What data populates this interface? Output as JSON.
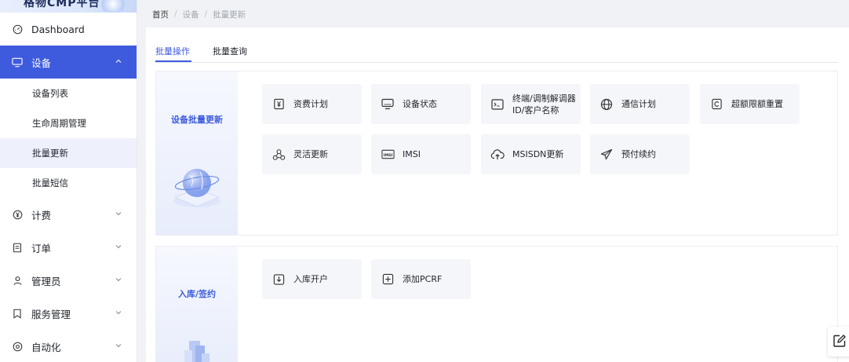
{
  "app": {
    "logo_text": "格物CMP平台"
  },
  "sidebar": {
    "items": [
      {
        "label": "Dashboard",
        "icon": "gauge-icon"
      },
      {
        "label": "设备",
        "icon": "monitor-icon",
        "active": true
      },
      {
        "label": "计费",
        "icon": "yen-icon"
      },
      {
        "label": "订单",
        "icon": "order-icon"
      },
      {
        "label": "管理员",
        "icon": "user-icon"
      },
      {
        "label": "服务管理",
        "icon": "bookmark-icon"
      },
      {
        "label": "自动化",
        "icon": "automation-icon"
      }
    ],
    "sub_items": [
      {
        "label": "设备列表"
      },
      {
        "label": "生命周期管理"
      },
      {
        "label": "批量更新",
        "current": true
      },
      {
        "label": "批量短信"
      }
    ]
  },
  "breadcrumb": {
    "home": "首页",
    "level1": "设备",
    "level2": "批量更新",
    "separator": "/"
  },
  "tabs": [
    {
      "label": "批量操作",
      "active": true
    },
    {
      "label": "批量查询"
    }
  ],
  "panels": [
    {
      "title": "设备批量更新",
      "cards": [
        {
          "label": "资费计划",
          "icon": "yen-doc-icon"
        },
        {
          "label": "设备状态",
          "icon": "monitor-icon"
        },
        {
          "label": "终端/调制解调器ID/客户名称",
          "label_line1": "终端/调制解调器",
          "label_line2": "ID/客户名称",
          "icon": "terminal-icon"
        },
        {
          "label": "通信计划",
          "icon": "globe-icon"
        },
        {
          "label": "超额限额重置",
          "icon": "reset-icon"
        },
        {
          "label": "灵活更新",
          "icon": "network-icon"
        },
        {
          "label": "IMSI",
          "icon": "imsi-icon"
        },
        {
          "label": "MSISDN更新",
          "icon": "cloud-upload-icon"
        },
        {
          "label": "预付续约",
          "icon": "send-icon"
        }
      ]
    },
    {
      "title": "入库/签约",
      "cards": [
        {
          "label": "入库开户",
          "icon": "download-box-icon"
        },
        {
          "label": "添加PCRF",
          "icon": "plus-box-icon"
        }
      ]
    }
  ],
  "colors": {
    "accent": "#3e5bde",
    "card_bg": "#f5f6f9",
    "page_bg": "#f0f2f5"
  }
}
